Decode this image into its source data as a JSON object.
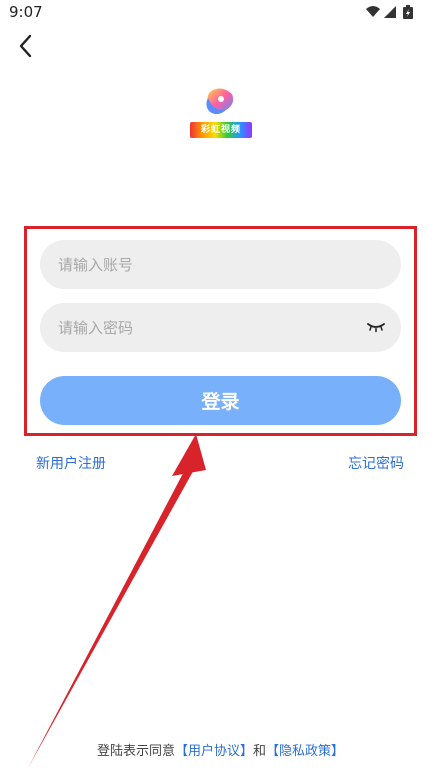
{
  "status_bar": {
    "time": "9:07",
    "icons": [
      "wifi-icon",
      "signal-icon",
      "battery-icon"
    ]
  },
  "logo": {
    "text": "彩虹视频"
  },
  "form": {
    "account_placeholder": "请输入账号",
    "password_placeholder": "请输入密码",
    "login_label": "登录"
  },
  "links": {
    "register": "新用户注册",
    "forgot": "忘记密码"
  },
  "agreement": {
    "prefix": "登陆表示同意",
    "user_agreement": "【用户协议】",
    "conjunction": "和",
    "privacy_policy": "【隐私政策】"
  },
  "colors": {
    "accent": "#79b0fb",
    "link": "#2b6fd6",
    "annotation": "#d8232a",
    "input_bg": "#eeeeee"
  }
}
